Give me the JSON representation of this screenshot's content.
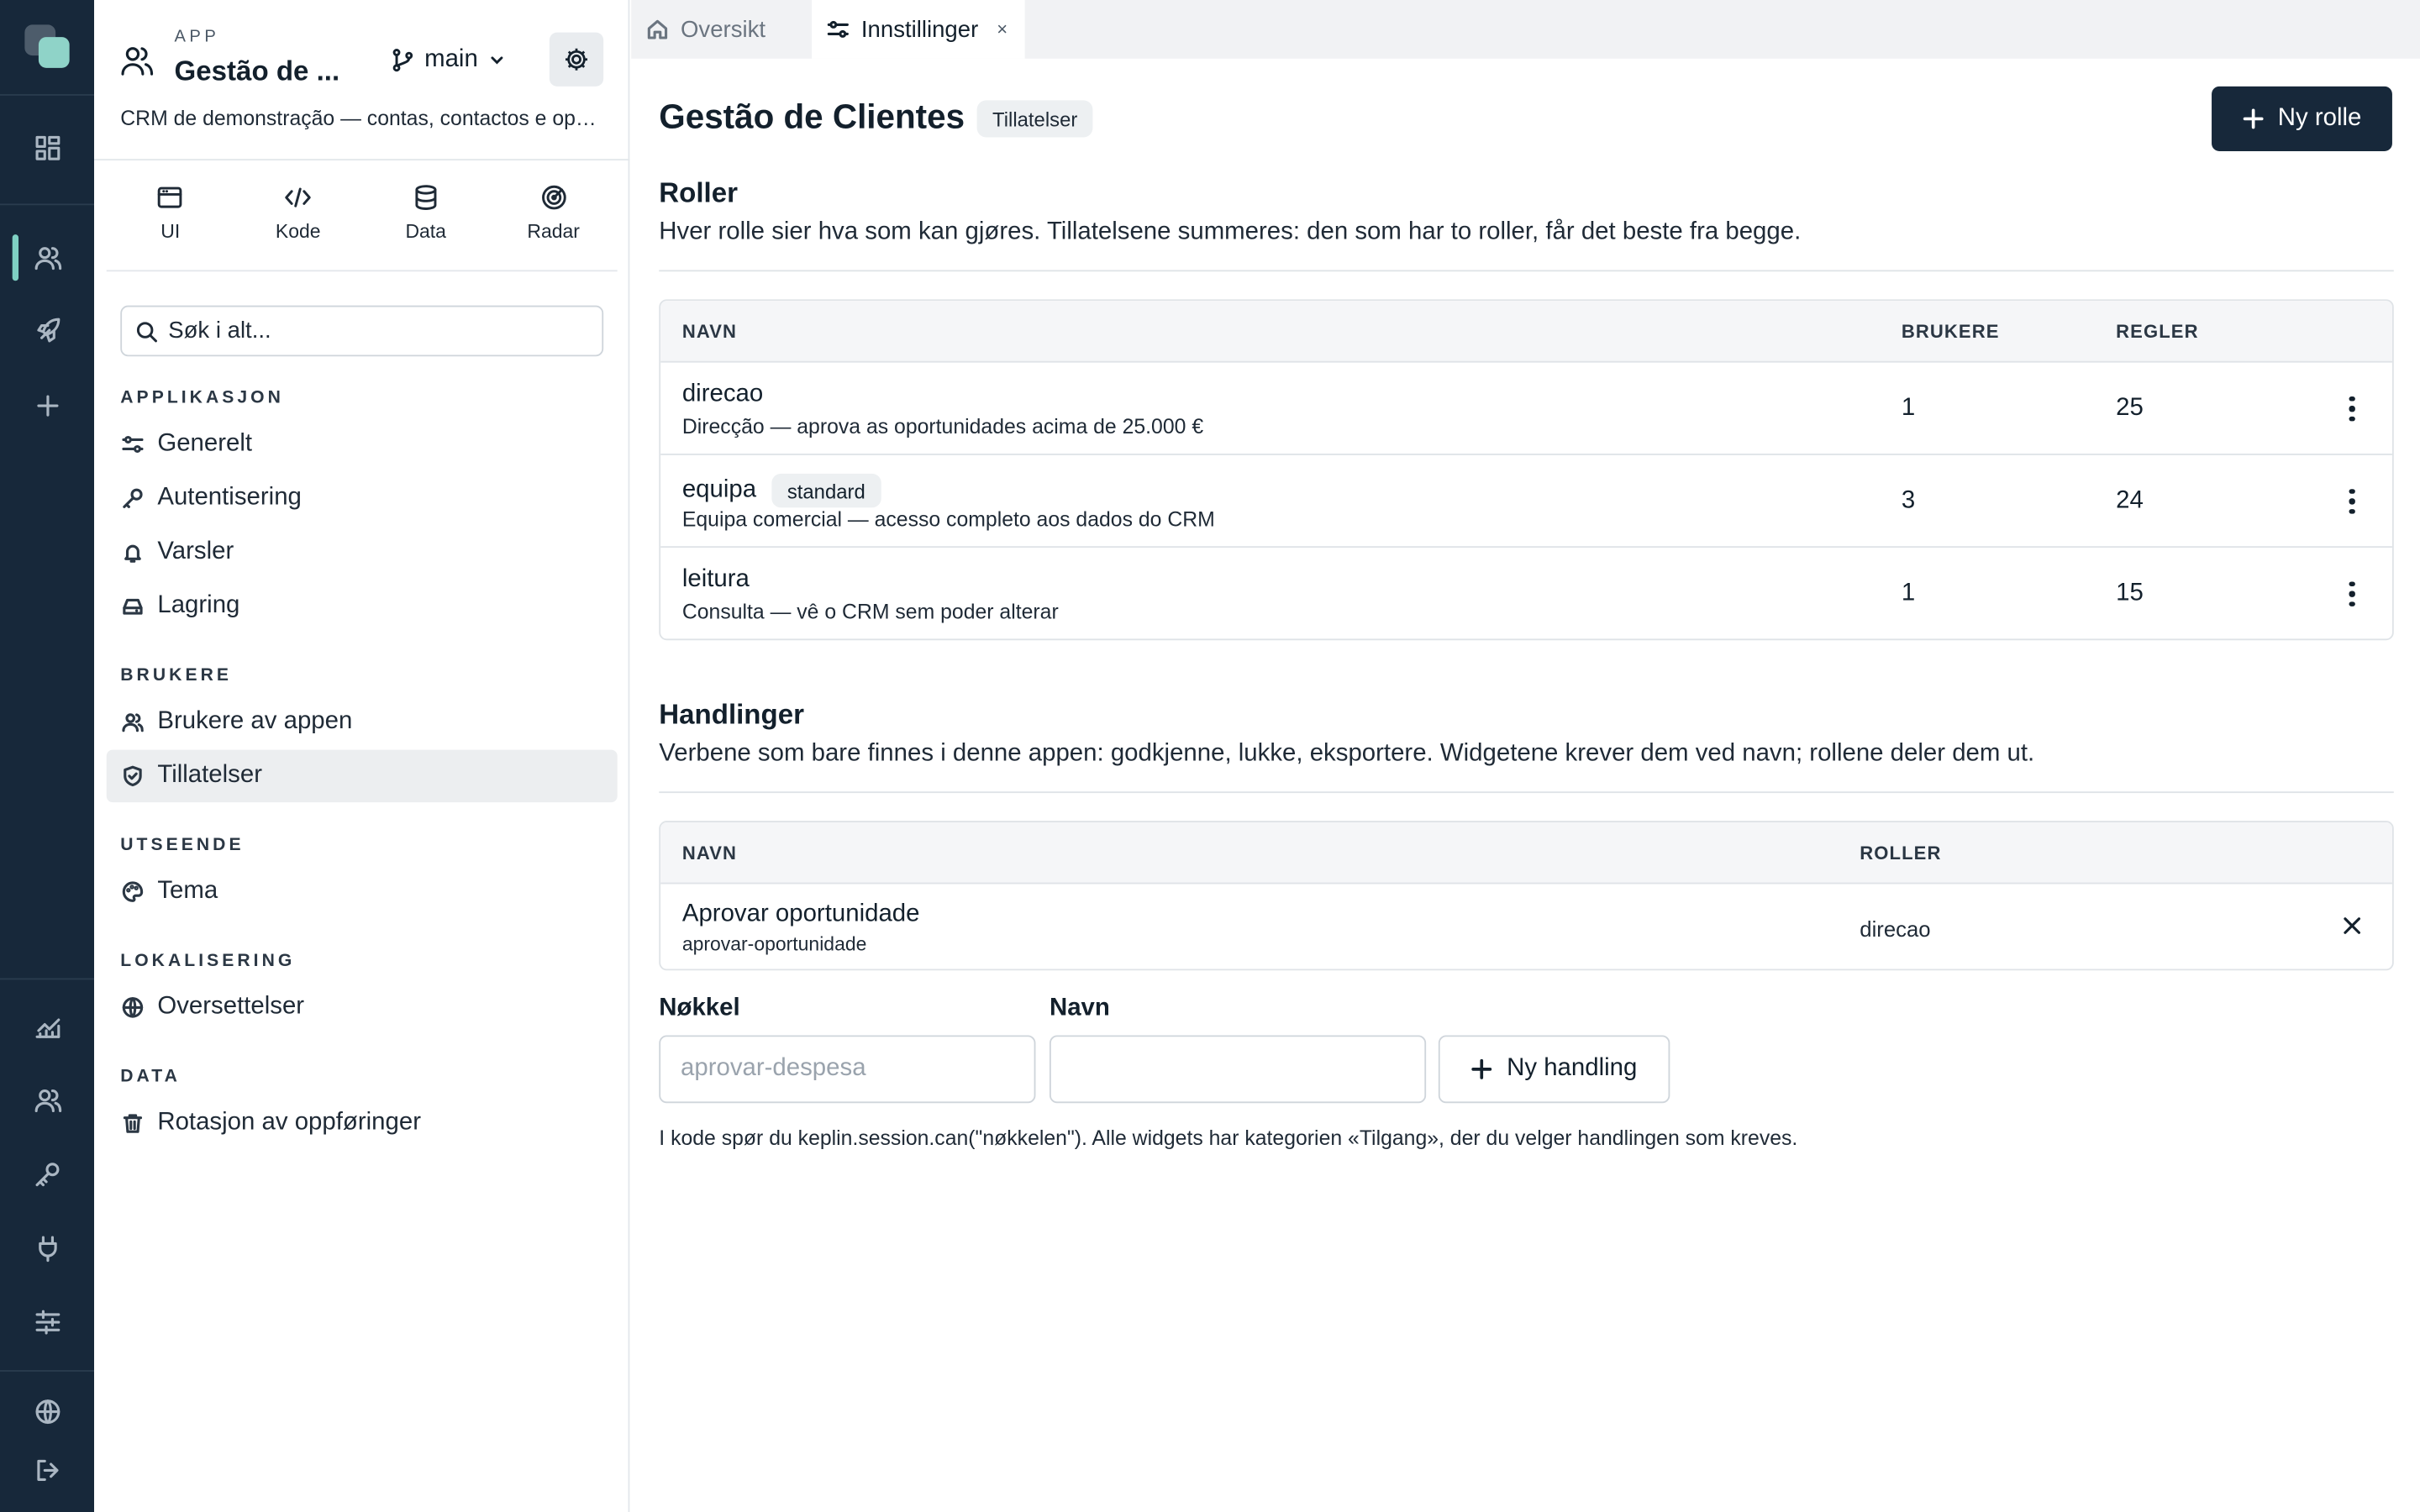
{
  "rail": {
    "icons": [
      "dashboard-icon",
      "users-icon",
      "rocket-icon",
      "plus-icon",
      "analytics-icon",
      "team-icon",
      "key-icon",
      "plug-icon",
      "sliders-icon",
      "globe-icon",
      "logout-icon"
    ]
  },
  "app": {
    "kicker": "APP",
    "name": "Gestão de ...",
    "branch": "main",
    "description": "CRM de demonstração — contas, contactos e oportunidades"
  },
  "views": [
    {
      "label": "UI",
      "icon": "browser-window-icon"
    },
    {
      "label": "Kode",
      "icon": "code-icon"
    },
    {
      "label": "Data",
      "icon": "database-icon"
    },
    {
      "label": "Radar",
      "icon": "radar-icon"
    }
  ],
  "search": {
    "placeholder": "Søk i alt..."
  },
  "sidebar": {
    "sections": [
      {
        "title": "APPLIKASJON",
        "items": [
          {
            "label": "Generelt",
            "icon": "sliders-icon"
          },
          {
            "label": "Autentisering",
            "icon": "key-icon"
          },
          {
            "label": "Varsler",
            "icon": "bell-icon"
          },
          {
            "label": "Lagring",
            "icon": "drive-icon"
          }
        ]
      },
      {
        "title": "BRUKERE",
        "items": [
          {
            "label": "Brukere av appen",
            "icon": "users-icon"
          },
          {
            "label": "Tillatelser",
            "icon": "shield-check-icon",
            "active": true
          }
        ]
      },
      {
        "title": "UTSEENDE",
        "items": [
          {
            "label": "Tema",
            "icon": "palette-icon"
          }
        ]
      },
      {
        "title": "LOKALISERING",
        "items": [
          {
            "label": "Oversettelser",
            "icon": "globe-icon"
          }
        ]
      },
      {
        "title": "DATA",
        "items": [
          {
            "label": "Rotasjon av oppføringer",
            "icon": "trash-icon"
          }
        ]
      }
    ]
  },
  "tabs": [
    {
      "label": "Oversikt",
      "icon": "home-icon",
      "active": false
    },
    {
      "label": "Innstillinger",
      "icon": "sliders-icon",
      "active": true,
      "close": "×"
    }
  ],
  "page": {
    "title": "Gestão de Clientes",
    "badge": "Tillatelser",
    "new_role_label": "Ny rolle"
  },
  "roles": {
    "heading": "Roller",
    "lead": "Hver rolle sier hva som kan gjøres. Tillatelsene summeres: den som har to roller, får det beste fra begge.",
    "columns": {
      "name": "NAVN",
      "users": "BRUKERE",
      "rules": "REGLER"
    },
    "rows": [
      {
        "name": "direcao",
        "badge": "",
        "description": "Direcção — aprova as oportunidades acima de 25.000 €",
        "users": "1",
        "rules": "25"
      },
      {
        "name": "equipa",
        "badge": "standard",
        "description": "Equipa comercial — acesso completo aos dados do CRM",
        "users": "3",
        "rules": "24"
      },
      {
        "name": "leitura",
        "badge": "",
        "description": "Consulta — vê o CRM sem poder alterar",
        "users": "1",
        "rules": "15"
      }
    ]
  },
  "actions": {
    "heading": "Handlinger",
    "lead": "Verbene som bare finnes i denne appen: godkjenne, lukke, eksportere. Widgetene krever dem ved navn; rollene deler dem ut.",
    "columns": {
      "name": "NAVN",
      "roles": "ROLLER"
    },
    "rows": [
      {
        "name": "Aprovar oportunidade",
        "key": "aprovar-oportunidade",
        "roles": "direcao"
      }
    ],
    "form": {
      "key_label": "Nøkkel",
      "key_placeholder": "aprovar-despesa",
      "name_label": "Navn",
      "name_value": "",
      "submit_label": "Ny handling"
    },
    "note": "I kode spør du keplin.session.can(\"nøkkelen\"). Alle widgets har kategorien «Tilgang», der du velger handlingen som kreves."
  },
  "colors": {
    "rail_bg": "#17283a",
    "accent": "#7fd0c3",
    "primary_button": "#17283a",
    "active_nav_bg": "#eceef0"
  }
}
